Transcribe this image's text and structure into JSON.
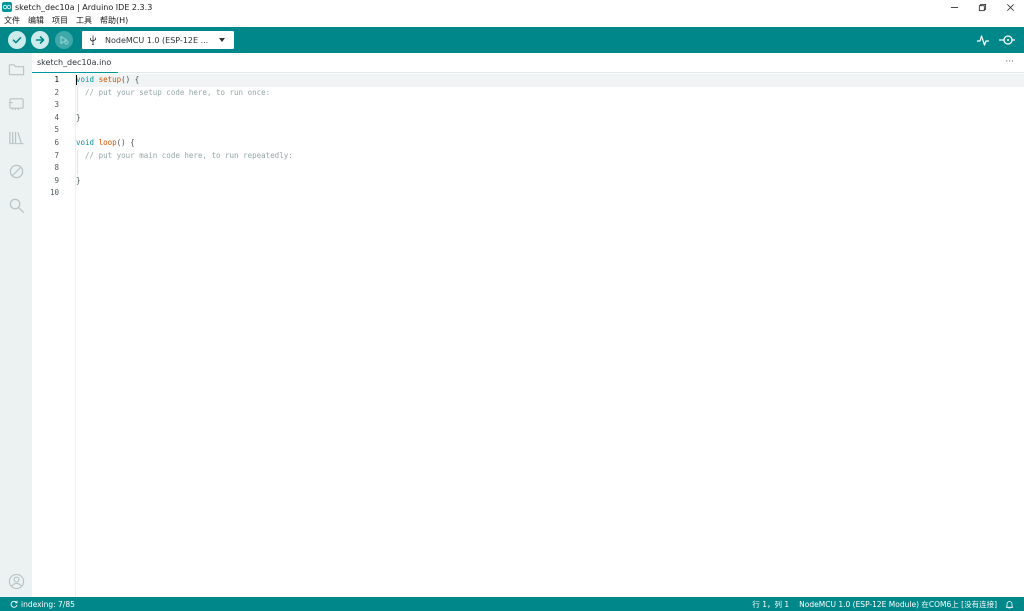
{
  "window": {
    "title": "sketch_dec10a | Arduino IDE 2.3.3"
  },
  "menu": {
    "items": [
      {
        "label": "文件"
      },
      {
        "label": "编辑"
      },
      {
        "label": "项目"
      },
      {
        "label": "工具"
      },
      {
        "label": "帮助(H)"
      }
    ]
  },
  "toolbar": {
    "verify_icon": "check-icon",
    "upload_icon": "arrow-right-icon",
    "debug_icon": "debug-icon",
    "board_selector": {
      "label": "NodeMCU 1.0 (ESP-12E ...",
      "icon": "usb-icon"
    },
    "plotter_icon": "serial-plotter-icon",
    "monitor_icon": "serial-monitor-icon"
  },
  "sidebar": {
    "items": [
      {
        "icon": "folder-icon",
        "name": "sketchbook"
      },
      {
        "icon": "board-manager-icon",
        "name": "boards-manager"
      },
      {
        "icon": "library-icon",
        "name": "library-manager"
      },
      {
        "icon": "debug-disabled-icon",
        "name": "debug"
      },
      {
        "icon": "search-icon",
        "name": "search"
      }
    ],
    "profile_icon": "account-icon"
  },
  "tabs": [
    {
      "label": "sketch_dec10a.ino",
      "active": true
    }
  ],
  "tab_more": "···",
  "editor": {
    "current_line": 1,
    "lines": [
      {
        "no": "1",
        "tokens": [
          {
            "t": "void",
            "c": "kw"
          },
          {
            "t": " ",
            "c": "plain"
          },
          {
            "t": "setup",
            "c": "fn"
          },
          {
            "t": "() {",
            "c": "plain"
          }
        ]
      },
      {
        "no": "2",
        "tokens": [
          {
            "t": "  // put your setup code here, to run once:",
            "c": "comment"
          }
        ]
      },
      {
        "no": "3",
        "tokens": []
      },
      {
        "no": "4",
        "tokens": [
          {
            "t": "}",
            "c": "plain"
          }
        ]
      },
      {
        "no": "5",
        "tokens": []
      },
      {
        "no": "6",
        "tokens": [
          {
            "t": "void",
            "c": "kw"
          },
          {
            "t": " ",
            "c": "plain"
          },
          {
            "t": "loop",
            "c": "fn"
          },
          {
            "t": "() {",
            "c": "plain"
          }
        ]
      },
      {
        "no": "7",
        "tokens": [
          {
            "t": "  // put your main code here, to run repeatedly:",
            "c": "comment"
          }
        ]
      },
      {
        "no": "8",
        "tokens": []
      },
      {
        "no": "9",
        "tokens": [
          {
            "t": "}",
            "c": "plain"
          }
        ]
      },
      {
        "no": "10",
        "tokens": []
      }
    ]
  },
  "statusbar": {
    "indexing": "indexing: 7/85",
    "position": "行 1，列 1",
    "board": "NodeMCU 1.0 (ESP-12E Module) 在COM6上 [没有连接]",
    "bell_icon": "bell-icon"
  },
  "colors": {
    "accent": "#00878a",
    "keyword": "#00979d",
    "function": "#d35400",
    "comment": "#95a5a6"
  }
}
